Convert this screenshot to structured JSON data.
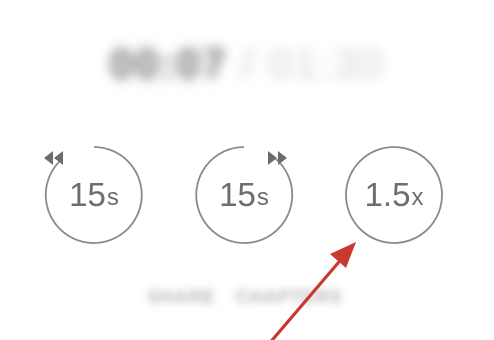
{
  "player": {
    "current_time": "00:07",
    "separator": "/",
    "total_time": "01:30"
  },
  "controls": {
    "rewind": {
      "amount": "15",
      "unit": "s",
      "icon": "rewind-icon"
    },
    "forward": {
      "amount": "15",
      "unit": "s",
      "icon": "fast-forward-icon"
    },
    "speed": {
      "value": "1.5",
      "unit": "x"
    }
  },
  "bottom_bar": {
    "items": [
      "SHARE",
      "CHAPTERS"
    ]
  },
  "annotation": {
    "color": "#c8392f"
  },
  "colors": {
    "control_stroke": "#8a8a8a",
    "control_text": "#6d6d6d"
  }
}
